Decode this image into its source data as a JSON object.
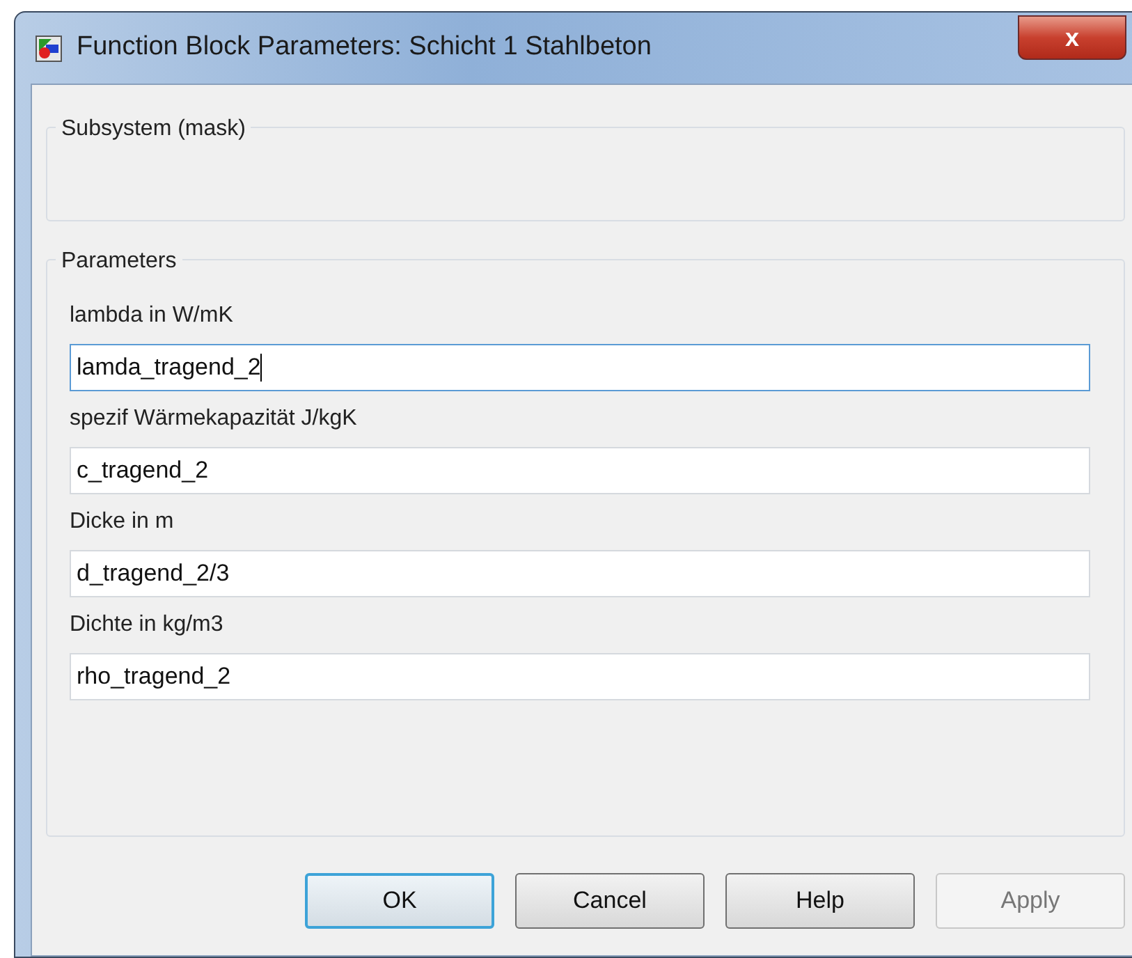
{
  "window": {
    "title": "Function Block Parameters: Schicht 1 Stahlbeton",
    "close": "x"
  },
  "mask_group": {
    "title": "Subsystem (mask)"
  },
  "parameters": {
    "title": "Parameters",
    "fields": [
      {
        "label": "lambda in W/mK",
        "value": "lamda_tragend_2",
        "focused": true
      },
      {
        "label": "spezif Wärmekapazität J/kgK",
        "value": "c_tragend_2",
        "focused": false
      },
      {
        "label": "Dicke in m",
        "value": "d_tragend_2/3",
        "focused": false
      },
      {
        "label": "Dichte in kg/m3",
        "value": "rho_tragend_2",
        "focused": false
      }
    ]
  },
  "buttons": [
    {
      "label": "OK",
      "default": true,
      "disabled": false
    },
    {
      "label": "Cancel",
      "default": false,
      "disabled": false
    },
    {
      "label": "Help",
      "default": false,
      "disabled": false
    },
    {
      "label": "Apply",
      "default": false,
      "disabled": true
    }
  ]
}
